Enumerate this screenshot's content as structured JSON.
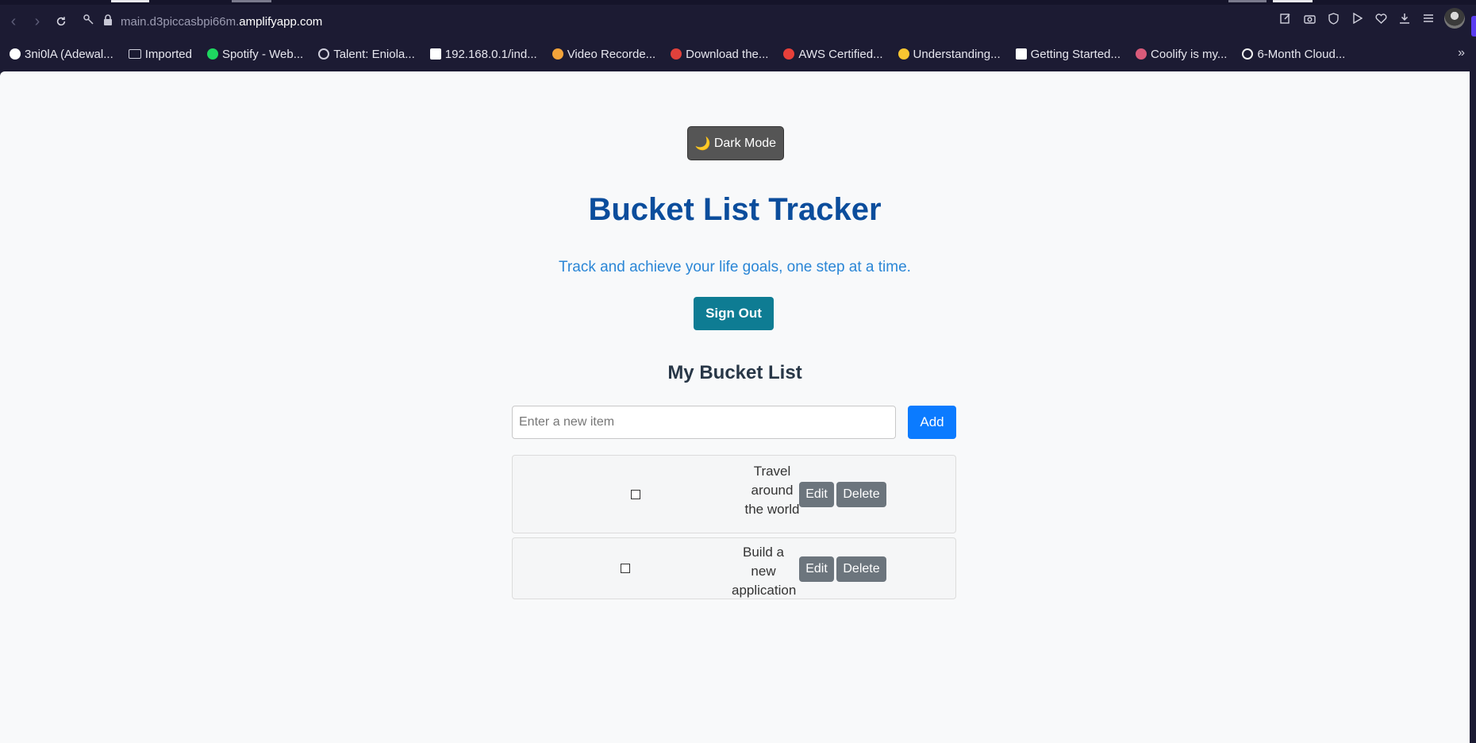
{
  "browser": {
    "url_prefix": "main.d3piccasbpi66m.",
    "url_host": "amplifyapp.com",
    "bookmarks": [
      {
        "label": "3ni0lA (Adewal...",
        "icon": "github-icon",
        "color": "#ffffff"
      },
      {
        "label": "Imported",
        "icon": "folder-icon",
        "color": "#cfcfdc"
      },
      {
        "label": "Spotify - Web...",
        "icon": "spotify-icon",
        "color": "#1ed760"
      },
      {
        "label": "Talent: Eniola...",
        "icon": "atom-icon",
        "color": "#cfcfdc"
      },
      {
        "label": "192.168.0.1/ind...",
        "icon": "router-icon",
        "color": "#ffffff"
      },
      {
        "label": "Video Recorde...",
        "icon": "recorder-icon",
        "color": "#f2a33a"
      },
      {
        "label": "Download the...",
        "icon": "store-icon",
        "color": "#e0413b"
      },
      {
        "label": "AWS Certified...",
        "icon": "aws-icon",
        "color": "#e8403a"
      },
      {
        "label": "Understanding...",
        "icon": "emoji-icon",
        "color": "#f7c531"
      },
      {
        "label": "Getting Started...",
        "icon": "medium-icon",
        "color": "#ffffff"
      },
      {
        "label": "Coolify is my...",
        "icon": "coolify-icon",
        "color": "#d95b7a"
      },
      {
        "label": "6-Month Cloud...",
        "icon": "circle-icon",
        "color": "#f0f0f0"
      }
    ],
    "overflow_label": "»"
  },
  "app": {
    "dark_mode_emoji": "🌙",
    "dark_mode_label": "Dark Mode",
    "title": "Bucket List Tracker",
    "subtitle": "Track and achieve your life goals, one step at a time.",
    "sign_out_label": "Sign Out",
    "list_heading": "My Bucket List",
    "new_item_placeholder": "Enter a new item",
    "new_item_value": "",
    "add_label": "Add",
    "items": [
      {
        "text": "Travel around the world",
        "checked": false,
        "edit_label": "Edit",
        "delete_label": "Delete"
      },
      {
        "text": "Build a new application",
        "checked": false,
        "edit_label": "Edit",
        "delete_label": "Delete"
      }
    ]
  },
  "colors": {
    "title": "#0b4d9c",
    "subtitle": "#2a86d6",
    "sign_out": "#0e7c93",
    "add": "#0b7bff",
    "secondary": "#6c757d"
  }
}
